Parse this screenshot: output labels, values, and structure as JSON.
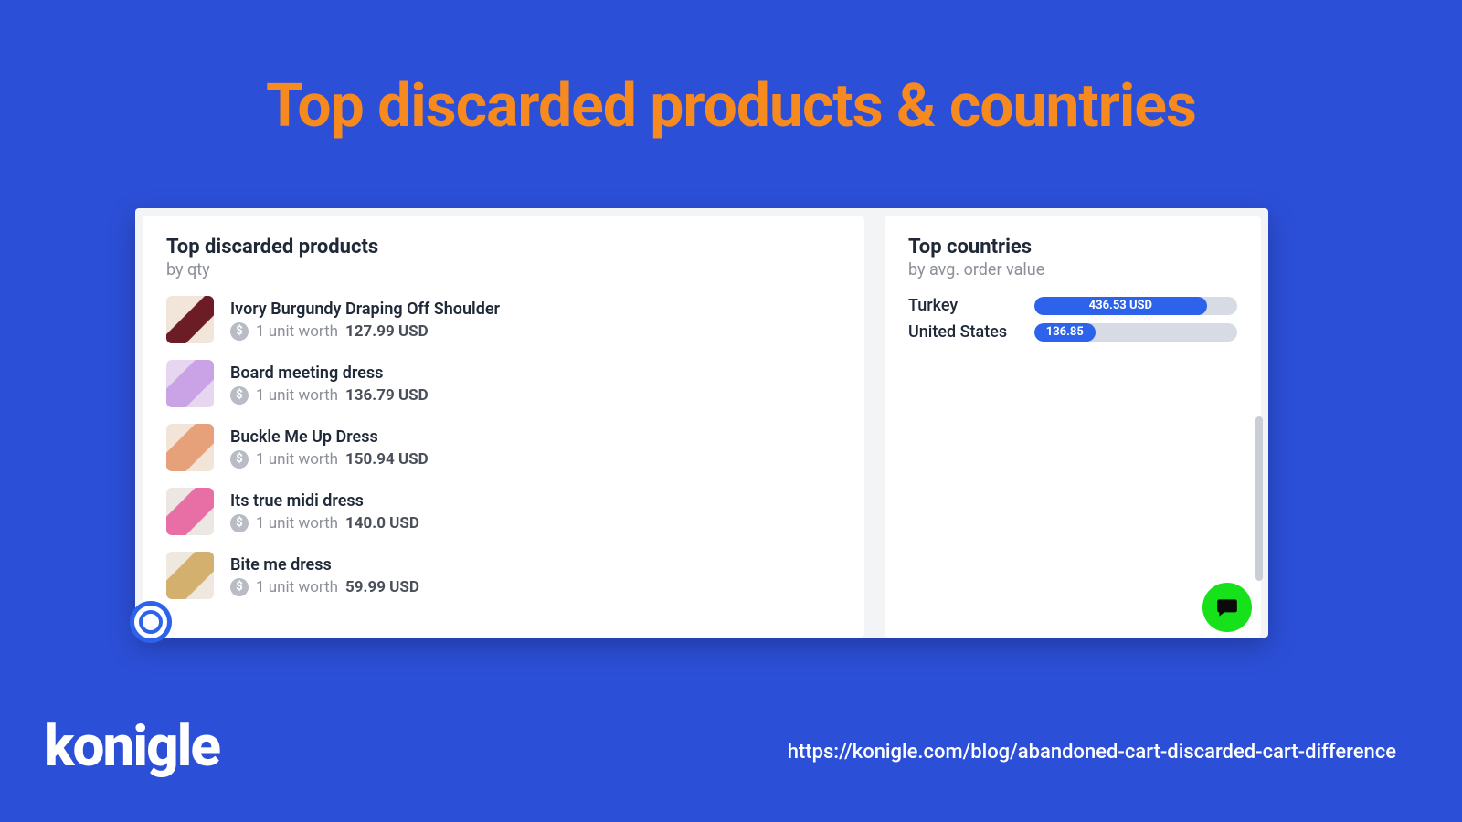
{
  "slide_title": "Top discarded products & countries",
  "products_panel": {
    "title": "Top discarded products",
    "subtitle": "by qty",
    "worth_prefix": "1 unit worth",
    "items": [
      {
        "name": "Ivory Burgundy Draping Off Shoulder",
        "value": "127.99 USD"
      },
      {
        "name": "Board meeting dress",
        "value": "136.79 USD"
      },
      {
        "name": "Buckle Me Up Dress",
        "value": "150.94 USD"
      },
      {
        "name": "Its true midi dress",
        "value": "140.0 USD"
      },
      {
        "name": "Bite me dress",
        "value": "59.99 USD"
      }
    ]
  },
  "countries_panel": {
    "title": "Top countries",
    "subtitle": "by avg. order value",
    "rows": [
      {
        "name": "Turkey",
        "label": "436.53 USD",
        "pct": 85
      },
      {
        "name": "United States",
        "label": "136.85",
        "pct": 30
      }
    ]
  },
  "brand": "konigle",
  "source_url": "https://konigle.com/blog/abandoned-cart-discarded-cart-difference",
  "chart_data": {
    "type": "bar",
    "title": "Top countries by avg. order value",
    "categories": [
      "Turkey",
      "United States"
    ],
    "values": [
      436.53,
      136.85
    ],
    "xlabel": "",
    "ylabel": "avg. order value (USD)",
    "ylim": [
      0,
      500
    ]
  }
}
